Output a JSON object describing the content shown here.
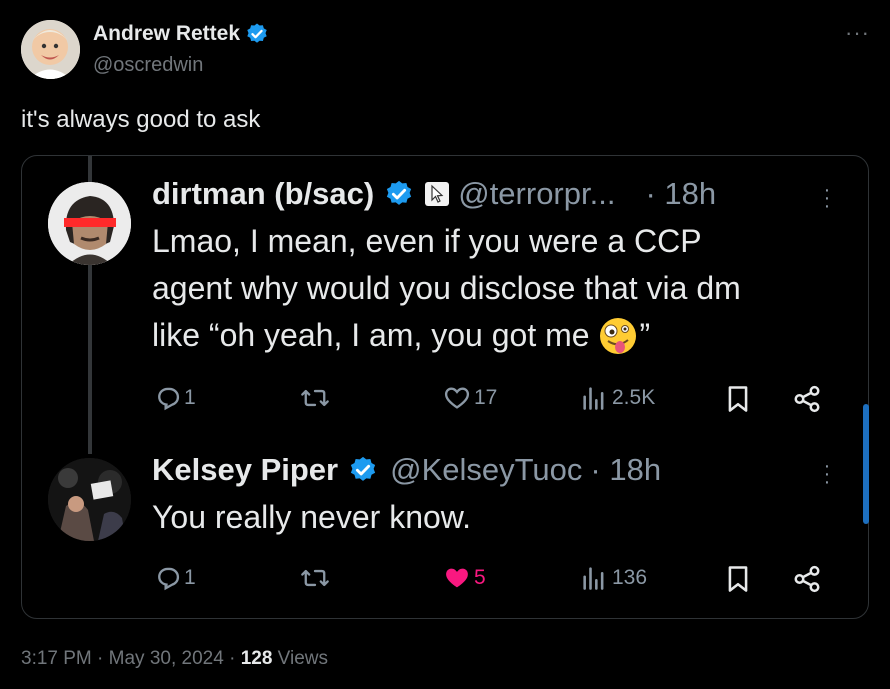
{
  "post": {
    "author_name": "Andrew Rettek",
    "author_handle": "@oscredwin",
    "text": "it's always good to ask",
    "more_label": "···"
  },
  "embed": {
    "tweet1": {
      "name": "dirtman (b/sac)",
      "handle": "@terrorpr...",
      "time": "· 18h",
      "text_line1": "Lmao, I mean, even if you were a CCP",
      "text_line2": "agent why would you disclose that via dm",
      "text_line3": "like “oh yeah, I am, you got me",
      "text_end": "”",
      "reply_count": "1",
      "retweet_count": "",
      "like_count": "17",
      "view_count": "2.5K"
    },
    "tweet2": {
      "name": "Kelsey Piper",
      "handle": "@KelseyTuoc",
      "time": "· 18h",
      "text": "You really never know.",
      "reply_count": "1",
      "retweet_count": "",
      "like_count": "5",
      "view_count": "136"
    }
  },
  "footer": {
    "time": "3:17 PM",
    "sep1": "·",
    "date": "May 30, 2024",
    "sep2": "·",
    "views_count": "128",
    "views_label": "Views"
  },
  "colors": {
    "verified": "#1d9bf0",
    "like_active": "#f91880",
    "muted": "#71767b",
    "text": "#e7e9ea"
  }
}
